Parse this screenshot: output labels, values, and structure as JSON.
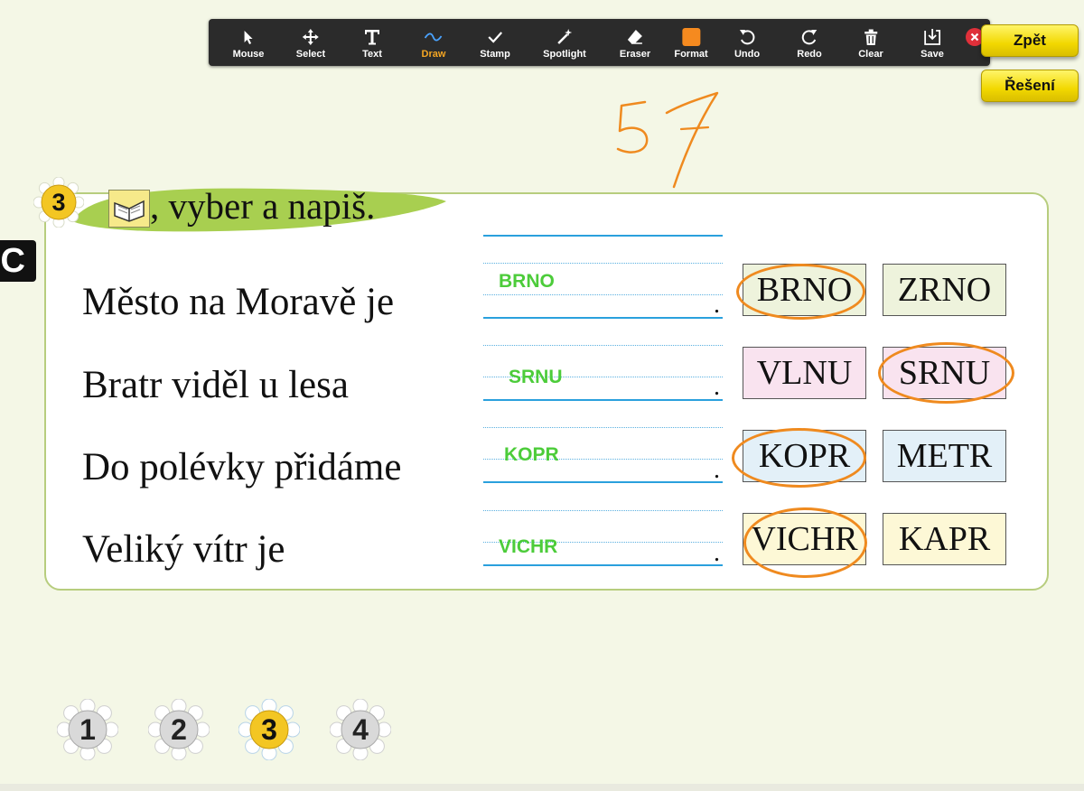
{
  "toolbar": {
    "tools": [
      {
        "label": "Mouse",
        "icon": "cursor-arrow-icon"
      },
      {
        "label": "Select",
        "icon": "move-arrows-icon"
      },
      {
        "label": "Text",
        "icon": "text-t-icon"
      },
      {
        "label": "Draw",
        "icon": "draw-wave-icon"
      },
      {
        "label": "Stamp",
        "icon": "checkmark-icon"
      },
      {
        "label": "Spotlight",
        "icon": "magic-wand-icon"
      },
      {
        "label": "Eraser",
        "icon": "eraser-icon"
      },
      {
        "label": "Format",
        "icon": "color-square-icon"
      },
      {
        "label": "Undo",
        "icon": "undo-icon"
      },
      {
        "label": "Redo",
        "icon": "redo-icon"
      },
      {
        "label": "Clear",
        "icon": "trash-icon"
      },
      {
        "label": "Save",
        "icon": "save-download-icon"
      }
    ],
    "active_tool": "Draw",
    "format_color": "#f58a1f"
  },
  "buttons": {
    "back": "Zpět",
    "solution": "Řešení"
  },
  "handwriting": "57",
  "side_mark": "IC",
  "exercise": {
    "number": "3",
    "title": ", vyber a napiš.",
    "rows": [
      {
        "sentence": "Město na Moravě je",
        "answer": "BRNO",
        "period": ".",
        "options": [
          "BRNO",
          "ZRNO"
        ],
        "circled": 0
      },
      {
        "sentence": "Bratr viděl u lesa",
        "answer": "SRNU",
        "period": ".",
        "options": [
          "VLNU",
          "SRNU"
        ],
        "circled": 1
      },
      {
        "sentence": "Do polévky přidáme",
        "answer": "KOPR",
        "period": ".",
        "options": [
          "KOPR",
          "METR"
        ],
        "circled": 0
      },
      {
        "sentence": "Veliký vítr je",
        "answer": "VICHR",
        "period": ".",
        "options": [
          "VICHR",
          "KAPR"
        ],
        "circled": 0
      }
    ]
  },
  "colors": {
    "panel_border": "#b7cd7e",
    "banner_green": "#a8cf50",
    "annotation_orange": "#ef8a1f",
    "answer_green": "#4ccc3a",
    "row_fills": [
      "#eef3dc",
      "#f9e3ef",
      "#e3f0f8",
      "#fdf8d6"
    ]
  },
  "pager": {
    "pages": [
      "1",
      "2",
      "3",
      "4"
    ],
    "current": "3"
  }
}
